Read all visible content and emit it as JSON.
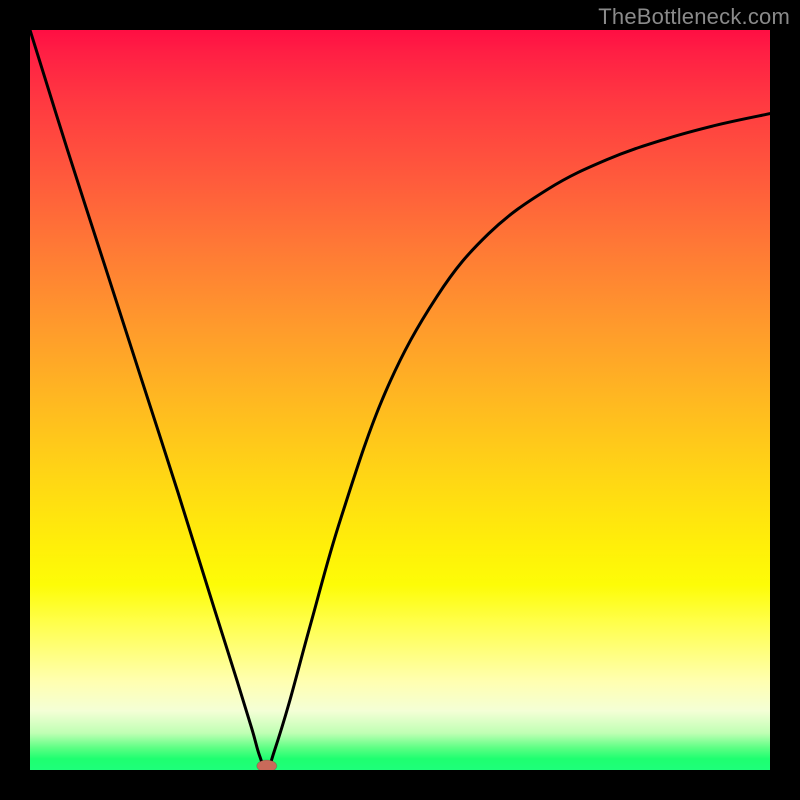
{
  "watermark": "TheBottleneck.com",
  "chart_data": {
    "type": "line",
    "title": "",
    "xlabel": "",
    "ylabel": "",
    "xlim": [
      0,
      100
    ],
    "ylim": [
      0,
      100
    ],
    "grid": false,
    "legend": false,
    "background_gradient": [
      "#ff0e43",
      "#ffb821",
      "#fdfc07",
      "#1eff7a"
    ],
    "series": [
      {
        "name": "bottleneck-curve",
        "x": [
          0,
          5,
          10,
          15,
          20,
          25,
          28,
          30,
          31,
          32,
          33,
          35,
          38,
          42,
          48,
          55,
          62,
          70,
          78,
          86,
          93,
          100
        ],
        "y": [
          100,
          84,
          68.5,
          53,
          37.5,
          21.5,
          12,
          5.5,
          2,
          0,
          2.5,
          9,
          20,
          34,
          51,
          64,
          72.5,
          78.5,
          82.5,
          85.3,
          87.2,
          88.7
        ]
      }
    ],
    "marker": {
      "x": 32,
      "y": 0,
      "shape": "oval",
      "color": "#c96a5a"
    }
  }
}
